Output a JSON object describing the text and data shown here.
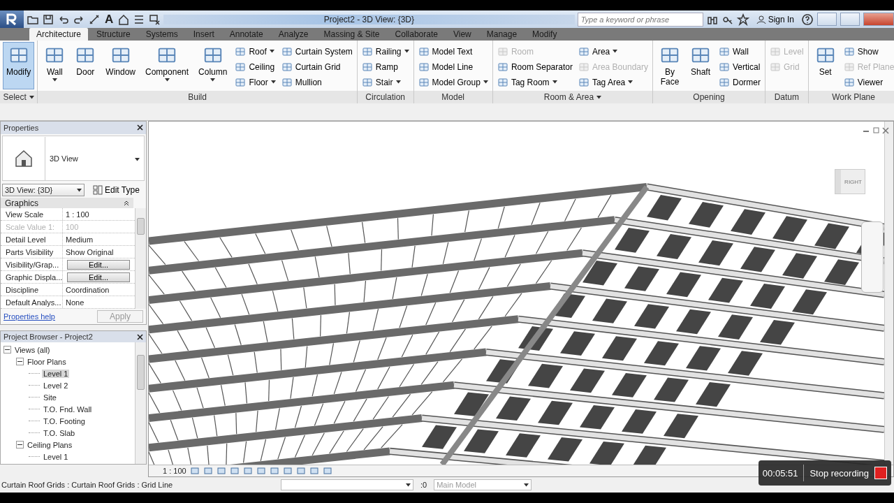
{
  "title_bar": {
    "title": "Project2 - 3D View: {3D}",
    "search": {
      "placeholder": "Type a keyword or phrase"
    },
    "sign_in": "Sign In",
    "text_tool": "A"
  },
  "tabs": [
    {
      "label": "Architecture",
      "selected": true
    },
    {
      "label": "Structure",
      "selected": false
    },
    {
      "label": "Systems",
      "selected": false
    },
    {
      "label": "Insert",
      "selected": false
    },
    {
      "label": "Annotate",
      "selected": false
    },
    {
      "label": "Analyze",
      "selected": false
    },
    {
      "label": "Massing & Site",
      "selected": false
    },
    {
      "label": "Collaborate",
      "selected": false
    },
    {
      "label": "View",
      "selected": false
    },
    {
      "label": "Manage",
      "selected": false
    },
    {
      "label": "Modify",
      "selected": false
    }
  ],
  "ribbon": {
    "panels": [
      {
        "label": "Select",
        "menu": true,
        "columns": [
          {
            "kind": "large",
            "items": [
              {
                "label": "Modify",
                "dropdown": false,
                "disabled": false,
                "active": true
              }
            ]
          }
        ]
      },
      {
        "label": "Build",
        "columns": [
          {
            "kind": "large",
            "items": [
              {
                "label": "Wall",
                "dropdown": true,
                "disabled": false,
                "active": false
              }
            ]
          },
          {
            "kind": "large",
            "items": [
              {
                "label": "Door",
                "dropdown": false,
                "disabled": false,
                "active": false
              }
            ]
          },
          {
            "kind": "large",
            "items": [
              {
                "label": "Window",
                "dropdown": false,
                "disabled": false,
                "active": false
              }
            ]
          },
          {
            "kind": "large",
            "items": [
              {
                "label": "Component",
                "dropdown": true,
                "disabled": false,
                "active": false
              }
            ]
          },
          {
            "kind": "large",
            "items": [
              {
                "label": "Column",
                "dropdown": true,
                "disabled": false,
                "active": false
              }
            ]
          },
          {
            "kind": "small",
            "items": [
              {
                "label": "Roof",
                "dropdown": true,
                "disabled": false,
                "active": false
              },
              {
                "label": "Ceiling",
                "dropdown": false,
                "disabled": false,
                "active": false
              },
              {
                "label": "Floor",
                "dropdown": true,
                "disabled": false,
                "active": false
              }
            ]
          },
          {
            "kind": "small",
            "items": [
              {
                "label": "Curtain System",
                "dropdown": false,
                "disabled": false,
                "active": false
              },
              {
                "label": "Curtain Grid",
                "dropdown": false,
                "disabled": false,
                "active": false
              },
              {
                "label": "Mullion",
                "dropdown": false,
                "disabled": false,
                "active": false
              }
            ]
          }
        ]
      },
      {
        "label": "Circulation",
        "columns": [
          {
            "kind": "small",
            "items": [
              {
                "label": "Railing",
                "dropdown": true,
                "disabled": false,
                "active": false
              },
              {
                "label": "Ramp",
                "dropdown": false,
                "disabled": false,
                "active": false
              },
              {
                "label": "Stair",
                "dropdown": true,
                "disabled": false,
                "active": false
              }
            ]
          }
        ]
      },
      {
        "label": "Model",
        "columns": [
          {
            "kind": "small",
            "items": [
              {
                "label": "Model Text",
                "dropdown": false,
                "disabled": false,
                "active": false
              },
              {
                "label": "Model Line",
                "dropdown": false,
                "disabled": false,
                "active": false
              },
              {
                "label": "Model Group",
                "dropdown": true,
                "disabled": false,
                "active": false
              }
            ]
          }
        ]
      },
      {
        "label": "Room & Area",
        "menu": true,
        "columns": [
          {
            "kind": "small",
            "items": [
              {
                "label": "Room",
                "dropdown": false,
                "disabled": true,
                "active": false
              },
              {
                "label": "Room Separator",
                "dropdown": false,
                "disabled": false,
                "active": false
              },
              {
                "label": "Tag Room",
                "dropdown": true,
                "disabled": false,
                "active": false
              }
            ]
          },
          {
            "kind": "small",
            "items": [
              {
                "label": "Area",
                "dropdown": true,
                "disabled": false,
                "active": false
              },
              {
                "label": "Area Boundary",
                "dropdown": false,
                "disabled": true,
                "active": false
              },
              {
                "label": "Tag Area",
                "dropdown": true,
                "disabled": false,
                "active": false
              }
            ]
          }
        ]
      },
      {
        "label": "Opening",
        "columns": [
          {
            "kind": "large",
            "items": [
              {
                "label": "By Face",
                "dropdown": false,
                "disabled": false,
                "active": false
              }
            ]
          },
          {
            "kind": "large",
            "items": [
              {
                "label": "Shaft",
                "dropdown": false,
                "disabled": false,
                "active": false
              }
            ]
          },
          {
            "kind": "small",
            "items": [
              {
                "label": "Wall",
                "dropdown": false,
                "disabled": false,
                "active": false
              },
              {
                "label": "Vertical",
                "dropdown": false,
                "disabled": false,
                "active": false
              },
              {
                "label": "Dormer",
                "dropdown": false,
                "disabled": false,
                "active": false
              }
            ]
          }
        ]
      },
      {
        "label": "Datum",
        "columns": [
          {
            "kind": "small",
            "items": [
              {
                "label": "Level",
                "dropdown": false,
                "disabled": true,
                "active": false
              },
              {
                "label": "Grid",
                "dropdown": false,
                "disabled": true,
                "active": false
              }
            ]
          }
        ]
      },
      {
        "label": "Work Plane",
        "columns": [
          {
            "kind": "large",
            "items": [
              {
                "label": "Set",
                "dropdown": false,
                "disabled": false,
                "active": false
              }
            ]
          },
          {
            "kind": "small",
            "items": [
              {
                "label": "Show",
                "dropdown": false,
                "disabled": false,
                "active": false
              },
              {
                "label": "Ref Plane",
                "dropdown": false,
                "disabled": true,
                "active": false
              },
              {
                "label": "Viewer",
                "dropdown": false,
                "disabled": false,
                "active": false
              }
            ]
          }
        ]
      }
    ]
  },
  "properties": {
    "title": "Properties",
    "type_name": "3D View",
    "instance": "3D View: {3D}",
    "edit_type": "Edit Type",
    "section": "Graphics",
    "rows": [
      {
        "name": "View Scale",
        "value": "1 : 100",
        "kind": "text",
        "disabled": false
      },
      {
        "name": "Scale Value    1:",
        "value": "100",
        "kind": "text",
        "disabled": true
      },
      {
        "name": "Detail Level",
        "value": "Medium",
        "kind": "text",
        "disabled": false
      },
      {
        "name": "Parts Visibility",
        "value": "Show Original",
        "kind": "text",
        "disabled": false
      },
      {
        "name": "Visibility/Grap...",
        "value": "Edit...",
        "kind": "button",
        "disabled": false
      },
      {
        "name": "Graphic Displa...",
        "value": "Edit...",
        "kind": "button",
        "disabled": false
      },
      {
        "name": "Discipline",
        "value": "Coordination",
        "kind": "text",
        "disabled": false
      },
      {
        "name": "Default Analys...",
        "value": "None",
        "kind": "text",
        "disabled": false
      }
    ],
    "help": "Properties help",
    "apply": "Apply"
  },
  "project_browser": {
    "title": "Project Browser - Project2",
    "tree": [
      {
        "label": "Views (all)",
        "expanded": true,
        "selected": false,
        "children": [
          {
            "label": "Floor Plans",
            "expanded": true,
            "selected": false,
            "children": [
              {
                "label": "Level 1",
                "selected": true
              },
              {
                "label": "Level 2",
                "selected": false
              },
              {
                "label": "Site",
                "selected": false
              },
              {
                "label": "T.O. Fnd. Wall",
                "selected": false
              },
              {
                "label": "T.O. Footing",
                "selected": false
              },
              {
                "label": "T.O. Slab",
                "selected": false
              }
            ]
          },
          {
            "label": "Ceiling Plans",
            "expanded": true,
            "selected": false,
            "children": [
              {
                "label": "Level 1",
                "selected": false
              }
            ]
          }
        ]
      }
    ]
  },
  "viewport": {
    "view_cube": "RIGHT",
    "scale": "1 : 100"
  },
  "status_bar": {
    "message": "Curtain Roof Grids : Curtain Roof Grids : Grid Line",
    "selection_count": ":0",
    "model": "Main Model"
  },
  "recording": {
    "time": "00:05:51",
    "action": "Stop recording"
  }
}
